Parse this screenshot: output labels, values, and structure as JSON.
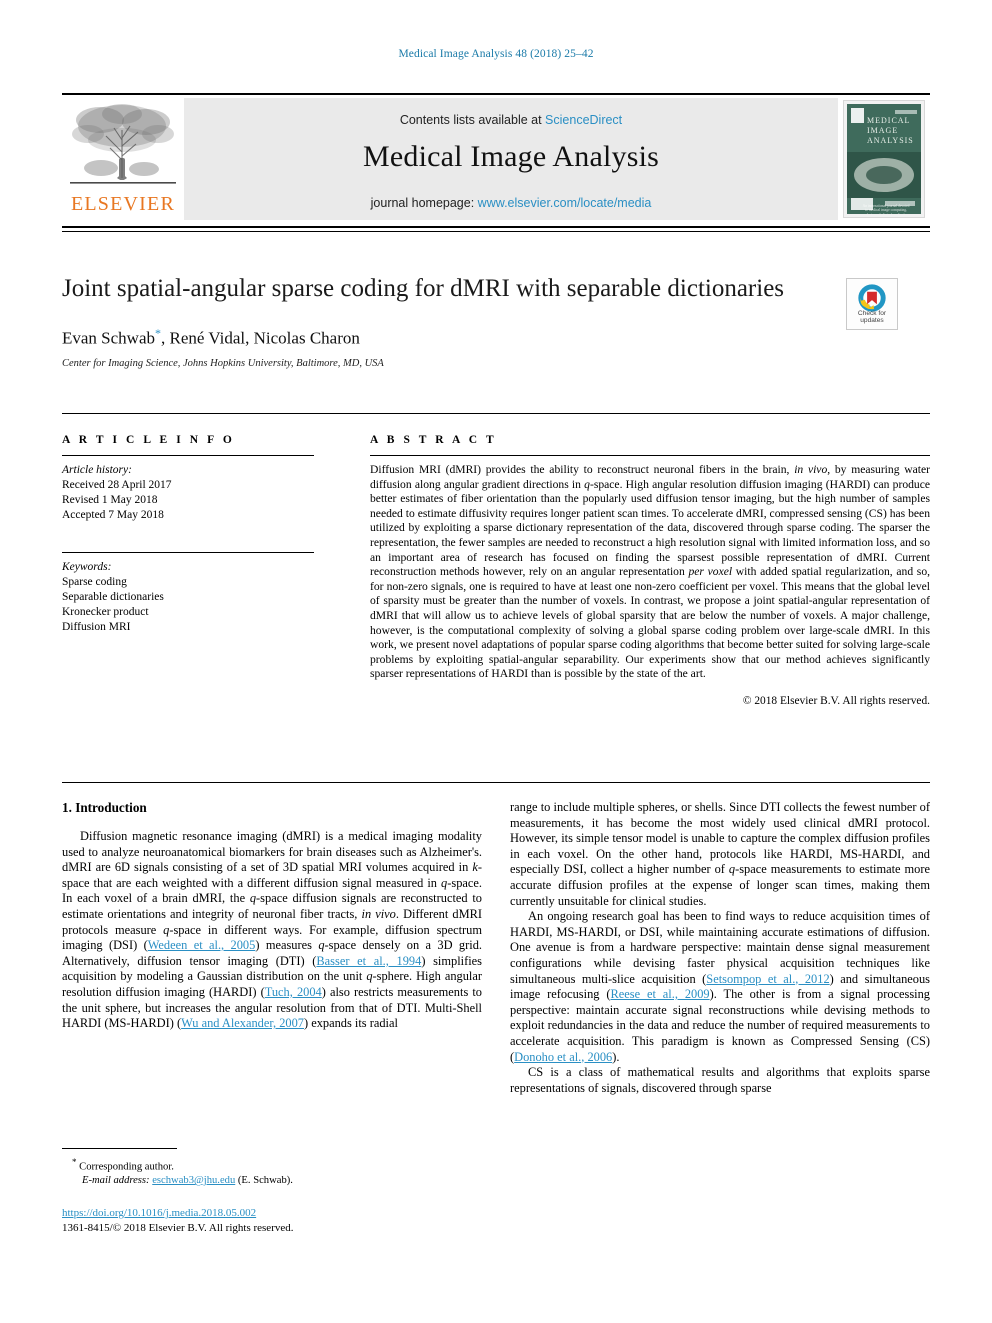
{
  "running_head": "Medical Image Analysis 48 (2018) 25–42",
  "masthead": {
    "contents_prefix": "Contents lists available at ",
    "sciencedirect": "ScienceDirect",
    "journal_title": "Medical Image Analysis",
    "homepage_prefix": "journal homepage: ",
    "homepage_url": "www.elsevier.com/locate/media",
    "publisher_wordmark": "ELSEVIER",
    "cover": {
      "line1": "MEDICAL",
      "line2": "IMAGE",
      "line3": "ANALYSIS",
      "blurb": "An international journal devoted to medical image computing, analysis, and clinical applications"
    }
  },
  "title_block": {
    "title": "Joint spatial-angular sparse coding for dMRI with separable dictionaries",
    "authors": "Evan Schwab",
    "authors_rest": ", René Vidal, Nicolas Charon",
    "corresponding_marker": "*",
    "affiliation": "Center for Imaging Science, Johns Hopkins University, Baltimore, MD, USA"
  },
  "crossmark": {
    "label_line1": "Check for",
    "label_line2": "updates"
  },
  "article_info": {
    "heading": "A R T I C L E  I N F O",
    "history_label": "Article history:",
    "received": "Received 28 April 2017",
    "revised": "Revised 1 May 2018",
    "accepted": "Accepted 7 May 2018",
    "keywords_label": "Keywords:",
    "keywords": [
      "Sparse coding",
      "Separable dictionaries",
      "Kronecker product",
      "Diffusion MRI"
    ]
  },
  "abstract": {
    "heading": "A B S T R A C T",
    "text_part1": "Diffusion MRI (dMRI) provides the ability to reconstruct neuronal fibers in the brain, ",
    "in_vivo_1": "in vivo",
    "text_part2": ", by measuring water diffusion along angular gradient directions in ",
    "q_1": "q",
    "text_part3": "-space. High angular resolution diffusion imaging (HARDI) can produce better estimates of fiber orientation than the popularly used diffusion tensor imaging, but the high number of samples needed to estimate diffusivity requires longer patient scan times. To accelerate dMRI, compressed sensing (CS) has been utilized by exploiting a sparse dictionary representation of the data, discovered through sparse coding. The sparser the representation, the fewer samples are needed to reconstruct a high resolution signal with limited information loss, and so an important area of research has focused on finding the sparsest possible representation of dMRI. Current reconstruction methods however, rely on an angular representation ",
    "per_voxel": "per voxel",
    "text_part4": " with added spatial regularization, and so, for non-zero signals, one is required to have at least one non-zero coefficient per voxel. This means that the global level of sparsity must be greater than the number of voxels. In contrast, we propose a joint spatial-angular representation of dMRI that will allow us to achieve levels of global sparsity that are below the number of voxels. A major challenge, however, is the computational complexity of solving a global sparse coding problem over large-scale dMRI. In this work, we present novel adaptations of popular sparse coding algorithms that become better suited for solving large-scale problems by exploiting spatial-angular separability. Our experiments show that our method achieves significantly sparser representations of HARDI than is possible by the state of the art.",
    "copyright": "© 2018 Elsevier B.V. All rights reserved."
  },
  "body": {
    "section_heading": "1. Introduction",
    "left_para1_a": "Diffusion magnetic resonance imaging (dMRI) is a medical imaging modality used to analyze neuroanatomical biomarkers for brain diseases such as Alzheimer's. dMRI are 6D signals consisting of a set of 3D spatial MRI volumes acquired in ",
    "left_k": "k",
    "left_para1_b": "-space that are each weighted with a different diffusion signal measured in ",
    "left_q1": "q",
    "left_para1_c": "-space. In each voxel of a brain dMRI, the ",
    "left_q2": "q",
    "left_para1_d": "-space diffusion signals are reconstructed to estimate orientations and integrity of neuronal fiber tracts, ",
    "left_invivo": "in vivo",
    "left_para1_e": ". Different dMRI protocols measure ",
    "left_q3": "q",
    "left_para1_f": "-space in different ways. For example, diffusion spectrum imaging (DSI) (",
    "cite_wedeen": "Wedeen et al., 2005",
    "left_para1_g": ") measures ",
    "left_q4": "q",
    "left_para1_h": "-space densely on a 3D grid. Alternatively, diffusion tensor imaging (DTI) (",
    "cite_basser": "Basser et al., 1994",
    "left_para1_i": ") simplifies acquisition by modeling a Gaussian distribution on the unit ",
    "left_q5": "q",
    "left_para1_j": "-sphere. High angular resolution diffusion imaging (HARDI) (",
    "cite_tuch": "Tuch, 2004",
    "left_para1_k": ") also restricts measurements to the unit sphere, but increases the angular resolution from that of DTI. Multi-Shell HARDI (MS-HARDI) (",
    "cite_wu": "Wu and Alexander, 2007",
    "left_para1_l": ") expands its radial",
    "right_para1_a": "range to include multiple spheres, or shells. Since DTI collects the fewest number of measurements, it has become the most widely used clinical dMRI protocol. However, its simple tensor model is unable to capture the complex diffusion profiles in each voxel. On the other hand, protocols like HARDI, MS-HARDI, and especially DSI, collect a higher number of ",
    "right_q1": "q",
    "right_para1_b": "-space measurements to estimate more accurate diffusion profiles at the expense of longer scan times, making them currently unsuitable for clinical studies.",
    "right_para2_a": "An ongoing research goal has been to find ways to reduce acquisition times of HARDI, MS-HARDI, or DSI, while maintaining accurate estimations of diffusion. One avenue is from a hardware perspective: maintain dense signal measurement configurations while devising faster physical acquisition techniques like simultaneous multi-slice acquisition (",
    "cite_setsompop": "Setsompop et al., 2012",
    "right_para2_b": ") and simultaneous image refocusing (",
    "cite_reese": "Reese et al., 2009",
    "right_para2_c": "). The other is from a signal processing perspective: maintain accurate signal reconstructions while devising methods to exploit redundancies in the data and reduce the number of required measurements to accelerate acquisition. This paradigm is known as Compressed Sensing (CS) (",
    "cite_donoho": "Donoho et al., 2006",
    "right_para2_d": ").",
    "right_para3": "CS is a class of mathematical results and algorithms that exploits sparse representations of signals, discovered through sparse"
  },
  "footnotes": {
    "corresponding": "Corresponding author.",
    "email_label": "E-mail address:",
    "email": "eschwab3@jhu.edu",
    "email_suffix": "(E. Schwab).",
    "doi": "https://doi.org/10.1016/j.media.2018.05.002",
    "issn": "1361-8415/© 2018 Elsevier B.V. All rights reserved."
  },
  "colors": {
    "link": "#2a8fc4",
    "elsevier_orange": "#E87722",
    "cover_green": "#3f6b5c"
  }
}
